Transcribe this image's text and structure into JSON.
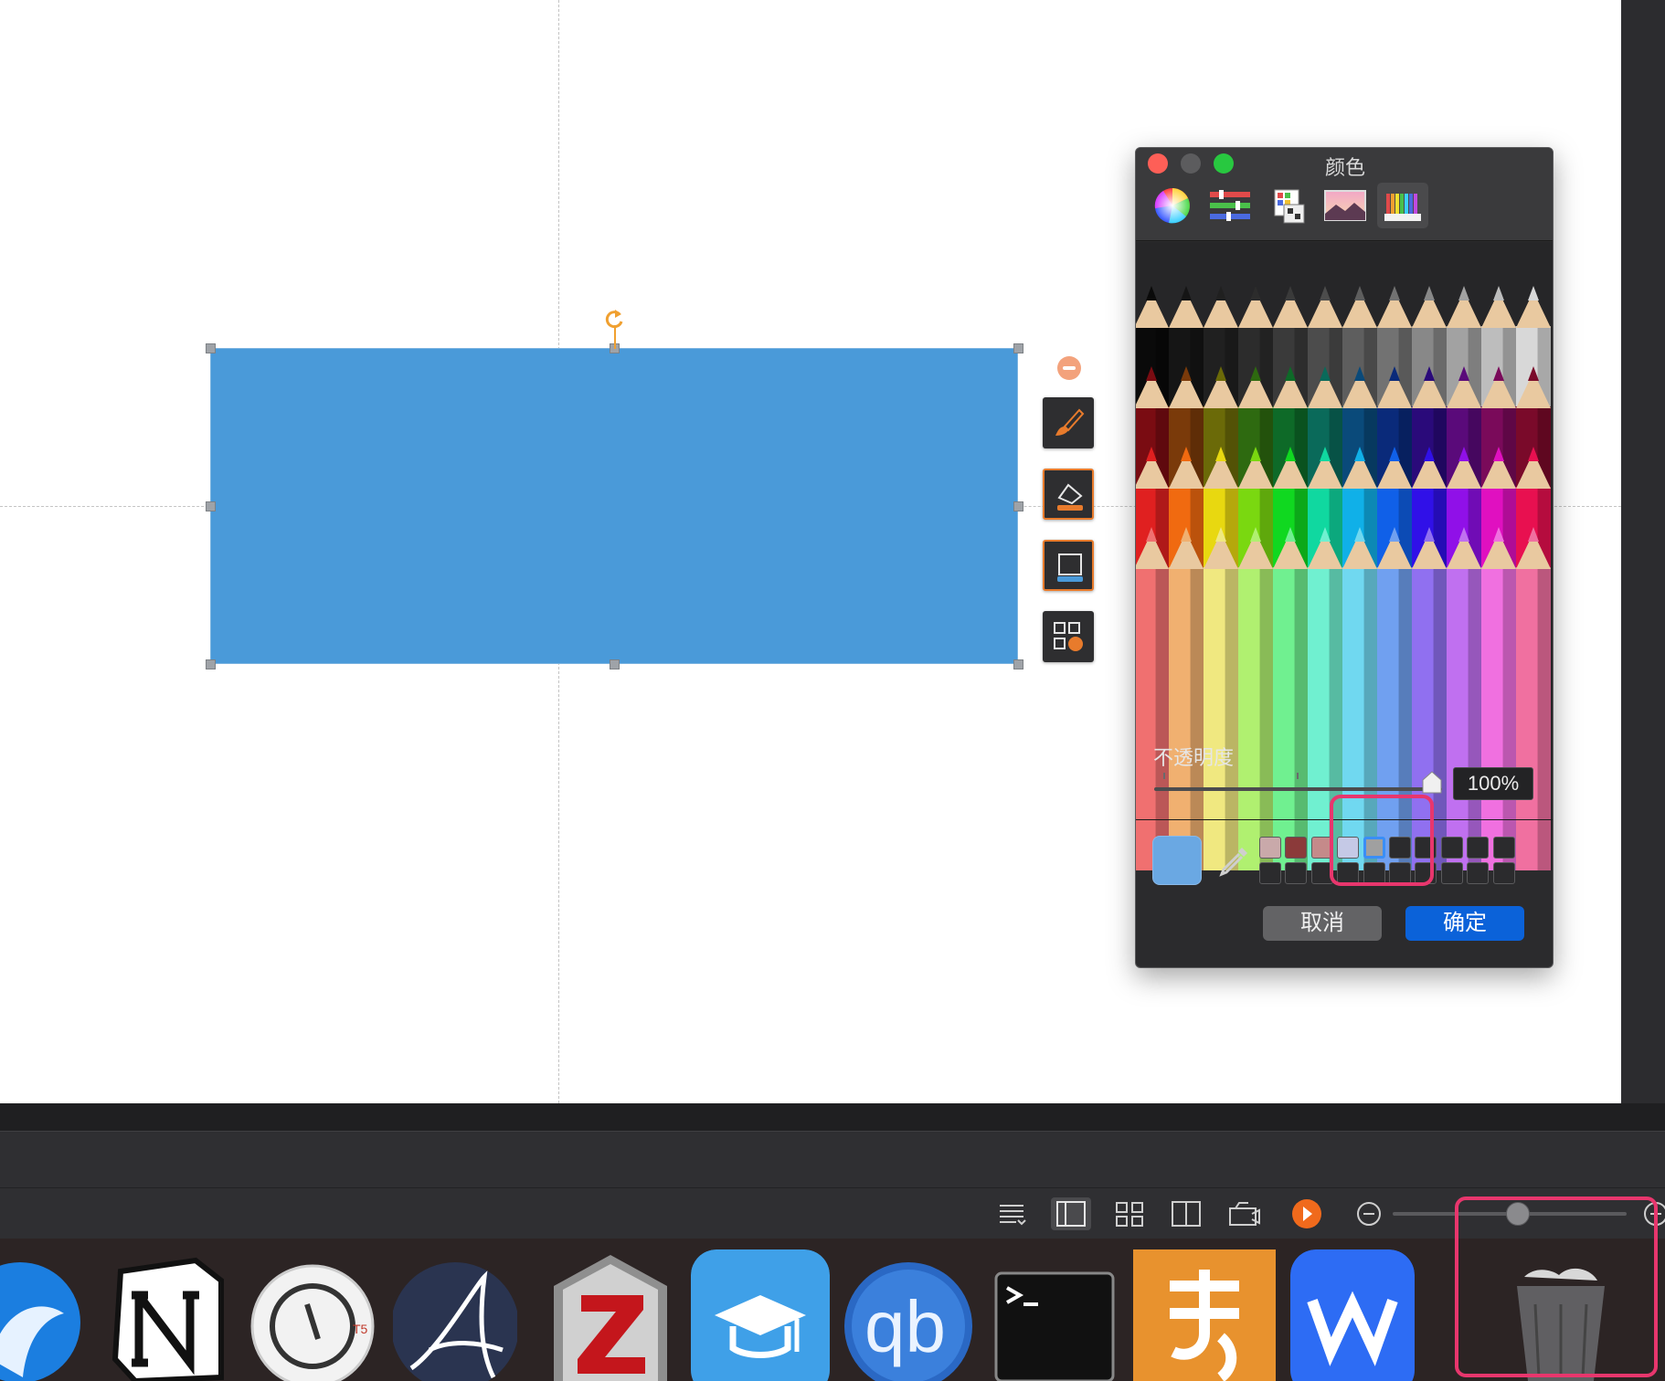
{
  "color_panel": {
    "title": "颜色",
    "modes": [
      {
        "name": "color-wheel",
        "icon": "color-wheel-icon"
      },
      {
        "name": "color-sliders",
        "icon": "sliders-icon"
      },
      {
        "name": "color-palettes",
        "icon": "palettes-icon"
      },
      {
        "name": "image-palettes",
        "icon": "image-icon"
      },
      {
        "name": "pencils",
        "icon": "pencils-icon",
        "selected": true
      }
    ],
    "opacity_label": "不透明度",
    "opacity_value": "100%",
    "opacity_percent": 100,
    "current_color": "#6aa8e3",
    "saved_swatches": [
      "#c9a9aa",
      "#8b3a3a",
      "#c58a8a",
      "#c5c9e6",
      "#a0a0a0"
    ],
    "cancel_label": "取消",
    "ok_label": "确定"
  },
  "shape": {
    "fill_color": "#4a9ad9"
  },
  "side_toolbar": {
    "tools": [
      "brush-icon",
      "fill-icon",
      "border-icon",
      "arrange-icon"
    ]
  },
  "view_bar": {
    "icons": [
      "outline-icon",
      "normal-view-icon",
      "grid-view-icon",
      "reading-view-icon",
      "presenter-icon",
      "play-icon",
      "zoom-out-icon",
      "zoom-in-icon"
    ]
  },
  "dock": {
    "apps": [
      "app-1",
      "notion",
      "timing",
      "app-a",
      "zotero",
      "study-app",
      "qbittorrent",
      "terminal",
      "app-9",
      "wps-office",
      "trash"
    ]
  }
}
